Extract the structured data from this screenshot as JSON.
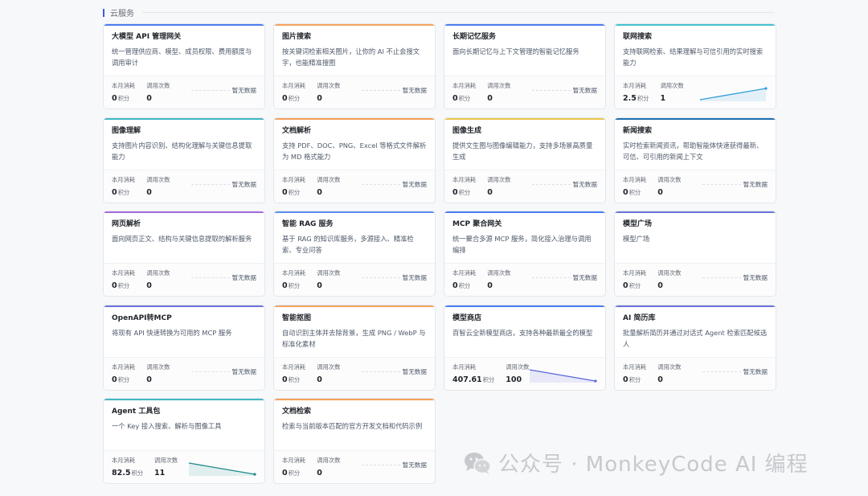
{
  "section": {
    "title": "云服务"
  },
  "labels": {
    "consumption": "本月消耗",
    "calls": "调用次数",
    "unit": "积分",
    "no_data": "暂无数据"
  },
  "cards": [
    {
      "title": "大模型 API 管理网关",
      "desc": "统一管理供应商、模型、成员权限、费用额度与调用审计",
      "consumption": "0",
      "calls": "0",
      "has_trend": false,
      "accent": "#4a7cf0"
    },
    {
      "title": "图片搜索",
      "desc": "按关键词检索相关图片，让你的 AI 不止会搜文字，也能精准搜图",
      "consumption": "0",
      "calls": "0",
      "has_trend": false,
      "accent": "#f5a25d"
    },
    {
      "title": "长期记忆服务",
      "desc": "面向长期记忆与上下文管理的智能记忆服务",
      "consumption": "0",
      "calls": "0",
      "has_trend": false,
      "accent": "#4a7cf0"
    },
    {
      "title": "联网搜索",
      "desc": "支持联网检索、结果理解与可信引用的实时搜索能力",
      "consumption": "2.5",
      "calls": "1",
      "has_trend": true,
      "trend_color": "#2f9fd8",
      "trend": [
        0,
        1
      ],
      "accent": "#45c1d1"
    },
    {
      "title": "图像理解",
      "desc": "支持图片内容识别、结构化理解与关键信息提取能力",
      "consumption": "0",
      "calls": "0",
      "has_trend": false,
      "accent": "#3fb8c4"
    },
    {
      "title": "文档解析",
      "desc": "支持 PDF、DOC、PNG、Excel 等格式文件解析为 MD 格式能力",
      "consumption": "0",
      "calls": "0",
      "has_trend": false,
      "accent": "#f5a25d"
    },
    {
      "title": "图像生成",
      "desc": "提供文生图与图像编辑能力，支持多场景高质量生成",
      "consumption": "0",
      "calls": "0",
      "has_trend": false,
      "accent": "#e8c64a"
    },
    {
      "title": "新闻搜索",
      "desc": "实时检索新闻资讯，帮助智能体快速获得最新、可信、可引用的新闻上下文",
      "consumption": "0",
      "calls": "0",
      "has_trend": false,
      "accent": "#1f6fb2"
    },
    {
      "title": "网页解析",
      "desc": "面向网页正文、结构与关键信息提取的解析服务",
      "consumption": "0",
      "calls": "0",
      "has_trend": false,
      "accent": "#a46cdc"
    },
    {
      "title": "智能 RAG 服务",
      "desc": "基于 RAG 的知识库服务，多源接入、精准检索、专业问答",
      "consumption": "0",
      "calls": "0",
      "has_trend": false,
      "accent": "#5b8def"
    },
    {
      "title": "MCP 聚合网关",
      "desc": "统一聚合多源 MCP 服务，简化接入治理与调用编排",
      "consumption": "0",
      "calls": "0",
      "has_trend": false,
      "accent": "#4a7cf0"
    },
    {
      "title": "模型广场",
      "desc": "模型广场",
      "consumption": "0",
      "calls": "0",
      "has_trend": false,
      "accent": "#6b74d6"
    },
    {
      "title": "OpenAPI转MCP",
      "desc": "将现有 API 快速转换为可用的 MCP 服务",
      "consumption": "0",
      "calls": "0",
      "has_trend": false,
      "accent": "#6b74d6"
    },
    {
      "title": "智能抠图",
      "desc": "自动识别主体并去除背景，生成 PNG / WebP 与标准化素材",
      "consumption": "0",
      "calls": "0",
      "has_trend": false,
      "accent": "#f5a25d"
    },
    {
      "title": "模型商店",
      "desc": "百智云全新模型商店，支持各种最新最全的模型",
      "consumption": "407.61",
      "calls": "100",
      "has_trend": true,
      "trend_color": "#5a66d8",
      "trend": [
        1,
        0
      ],
      "accent": "#4a7cf0"
    },
    {
      "title": "AI 简历库",
      "desc": "批量解析简历并通过对话式 Agent 检索匹配候选人",
      "consumption": "0",
      "calls": "0",
      "has_trend": false,
      "accent": "#6b74d6"
    },
    {
      "title": "Agent 工具包",
      "desc": "一个 Key 接入搜索、解析与图像工具",
      "consumption": "82.5",
      "calls": "11",
      "has_trend": true,
      "trend_color": "#1e8a8a",
      "trend": [
        1,
        0
      ],
      "accent": "#3fb8c4"
    },
    {
      "title": "文档检索",
      "desc": "检索与当前版本匹配的官方开发文档和代码示例",
      "consumption": "0",
      "calls": "0",
      "has_trend": false,
      "accent": "#f5a25d"
    }
  ],
  "watermark": {
    "text": "公众号 · MonkeyCode AI 编程",
    "icon": "wechat-icon"
  }
}
